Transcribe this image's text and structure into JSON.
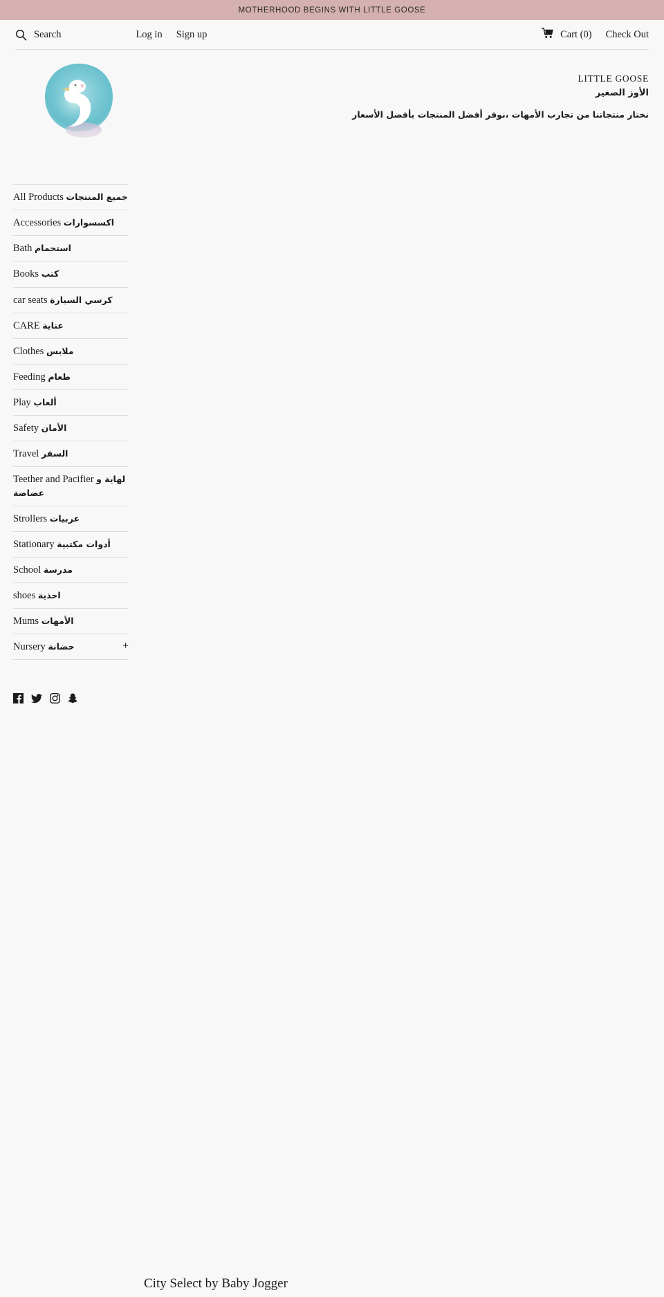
{
  "announcement": {
    "text": "MOTHERHOOD BEGINS WITH LITTLE GOOSE",
    "background": "#d5b0b0"
  },
  "utilbar": {
    "search_label": "Search",
    "search_icon": "search-icon",
    "login_label": "Log in",
    "signup_label": "Sign up",
    "cart_icon": "shopping-cart-icon",
    "cart_label": "Cart (0)",
    "cart_count": 0,
    "checkout_label": "Check Out"
  },
  "masthead": {
    "logo_alt": "swan-logo",
    "brand_en": "LITTLE GOOSE",
    "brand_ar": "الأوز الصغير",
    "tagline_ar": "نختار منتجاتنا من تجارب الأمهات ،نوفر  أفضل المنتجات بأفضل الأسعار"
  },
  "sidebar": {
    "items": [
      {
        "en": "All Products",
        "ar": "جميع المنتجات",
        "expandable": false
      },
      {
        "en": "Accessories",
        "ar": "اكسسوارات",
        "expandable": false
      },
      {
        "en": "Bath",
        "ar": "استحمام",
        "expandable": false
      },
      {
        "en": "Books",
        "ar": "كتب",
        "expandable": false
      },
      {
        "en": "car seats",
        "ar": "كرسي السيارة",
        "expandable": false
      },
      {
        "en": "CARE",
        "ar": "عناية",
        "expandable": false
      },
      {
        "en": "Clothes",
        "ar": "ملابس",
        "expandable": false
      },
      {
        "en": "Feeding",
        "ar": "طعام",
        "expandable": false
      },
      {
        "en": "Play",
        "ar": "ألعاب",
        "expandable": false
      },
      {
        "en": "Safety",
        "ar": "الأمان",
        "expandable": false
      },
      {
        "en": "Travel",
        "ar": "السفر",
        "expandable": false
      },
      {
        "en": "Teether and Pacifier",
        "ar": "لهاية و عضاضة",
        "expandable": false
      },
      {
        "en": "Strollers",
        "ar": "عربيات",
        "expandable": false
      },
      {
        "en": "Stationary",
        "ar": "أدوات مكتبية",
        "expandable": false
      },
      {
        "en": "School",
        "ar": "مدرسة",
        "expandable": false
      },
      {
        "en": "shoes",
        "ar": "احذية",
        "expandable": false
      },
      {
        "en": "Mums",
        "ar": "الأمهات",
        "expandable": false
      },
      {
        "en": "Nursery",
        "ar": "حضانة",
        "expandable": true,
        "expand_symbol": "+"
      }
    ],
    "socials": [
      {
        "name": "facebook-icon"
      },
      {
        "name": "twitter-icon"
      },
      {
        "name": "instagram-icon"
      },
      {
        "name": "snapchat-icon"
      }
    ]
  },
  "main": {
    "product_title": "City Select by Baby Jogger"
  },
  "colors": {
    "page_background": "#f8f8f8",
    "banner": "#d5b0b0",
    "text": "#1c1c1c",
    "divider": "#dcdcdc"
  }
}
